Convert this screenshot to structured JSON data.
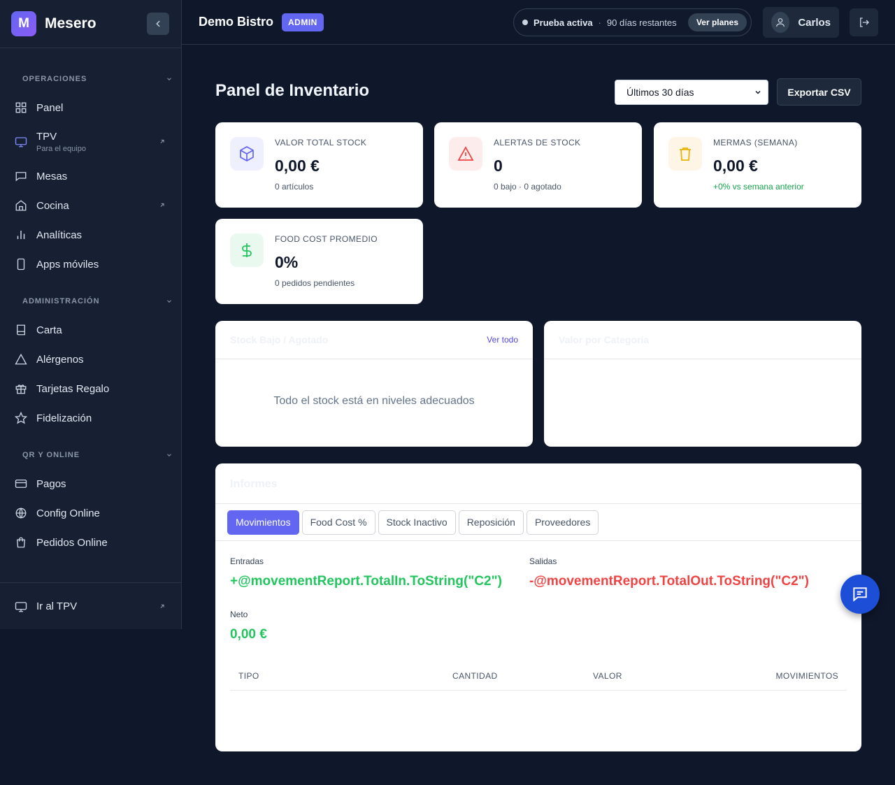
{
  "brand": {
    "logo_letter": "M",
    "name": "Mesero"
  },
  "sidebar": {
    "sections": [
      {
        "title": "OPERACIONES",
        "items": [
          {
            "label": "Panel",
            "icon": "grid-icon"
          },
          {
            "label": "TPV",
            "sub": "Para el equipo",
            "icon": "monitor-icon",
            "external": true
          },
          {
            "label": "Mesas",
            "icon": "message-square-icon"
          },
          {
            "label": "Cocina",
            "icon": "home-icon",
            "external": true
          },
          {
            "label": "Analíticas",
            "icon": "bar-chart-icon"
          },
          {
            "label": "Apps móviles",
            "icon": "smartphone-icon"
          }
        ]
      },
      {
        "title": "ADMINISTRACIÓN",
        "items": [
          {
            "label": "Carta",
            "icon": "book-icon"
          },
          {
            "label": "Alérgenos",
            "icon": "triangle-icon"
          },
          {
            "label": "Tarjetas Regalo",
            "icon": "gift-icon"
          },
          {
            "label": "Fidelización",
            "icon": "star-icon"
          }
        ]
      },
      {
        "title": "QR Y ONLINE",
        "items": [
          {
            "label": "Pagos",
            "icon": "credit-card-icon"
          },
          {
            "label": "Config Online",
            "icon": "globe-icon"
          },
          {
            "label": "Pedidos Online",
            "icon": "shopping-bag-icon"
          }
        ]
      }
    ],
    "footer": {
      "label": "Ir al TPV",
      "icon": "monitor-icon"
    }
  },
  "header": {
    "shop_name": "Demo Bistro",
    "role_badge": "ADMIN",
    "trial_status": "Prueba activa",
    "trial_separator": "·",
    "trial_remaining": "90 días restantes",
    "plans_label": "Ver planes",
    "user_name": "Carlos"
  },
  "main": {
    "title": "Panel de Inventario",
    "range_selected": "Últimos 30 días",
    "export_label": "Exportar CSV",
    "stats": [
      {
        "label": "VALOR TOTAL STOCK",
        "value": "0,00 €",
        "sub": "0 artículos",
        "icon": "box-icon",
        "icon_color": "#6366f1",
        "icon_bg": "#eef0fd"
      },
      {
        "label": "ALERTAS DE STOCK",
        "value": "0",
        "sub": "0 bajo · 0 agotado",
        "icon": "alert-triangle-icon",
        "icon_color": "#ef4444",
        "icon_bg": "#fdecec"
      },
      {
        "label": "MERMAS (SEMANA)",
        "value": "0,00 €",
        "sub": "+0% vs semana anterior",
        "icon": "trash-icon",
        "icon_color": "#eab308",
        "icon_bg": "#fef5e7",
        "sub_color": "#16a34a"
      },
      {
        "label": "FOOD COST PROMEDIO",
        "value": "0%",
        "sub": "0 pedidos pendientes",
        "icon": "dollar-icon",
        "icon_color": "#22c55e",
        "icon_bg": "#e9f9ef"
      }
    ],
    "low_stock": {
      "title": "Stock Bajo / Agotado",
      "see_all": "Ver todo",
      "empty": "Todo el stock está en niveles adecuados"
    },
    "by_category": {
      "title": "Valor por Categoría"
    },
    "reports": {
      "title": "Informes",
      "tabs": [
        "Movimientos",
        "Food Cost %",
        "Stock Inactivo",
        "Reposición",
        "Proveedores"
      ],
      "active_tab": "Movimientos",
      "in_label": "Entradas",
      "in_value": "+@movementReport.TotalIn.ToString(\"C2\")",
      "out_label": "Salidas",
      "out_value": "-@movementReport.TotalOut.ToString(\"C2\")",
      "net_label": "Neto",
      "net_value": "0,00 €",
      "columns": [
        "TIPO",
        "CANTIDAD",
        "VALOR",
        "MOVIMIENTOS"
      ]
    }
  },
  "colors": {
    "accent": "#6366f1",
    "positive": "#22c55e",
    "negative": "#ef4444",
    "background": "#0f172a"
  }
}
